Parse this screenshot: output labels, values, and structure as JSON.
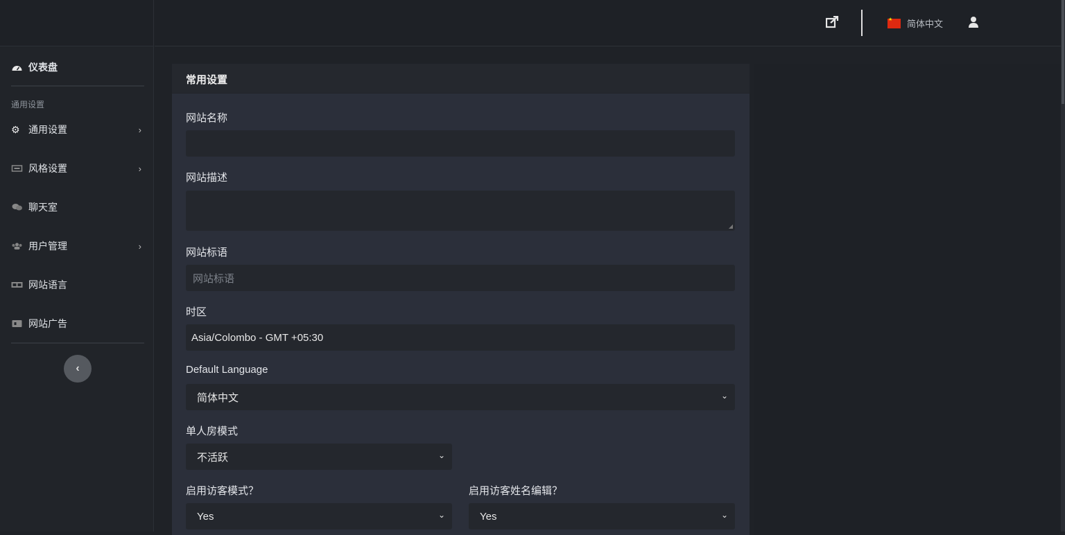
{
  "sidebar": {
    "dashboard": "仪表盘",
    "section_label": "通用设置",
    "items": [
      {
        "label": "通用设置",
        "icon": "gear-icon",
        "has_children": true
      },
      {
        "label": "风格设置",
        "icon": "theme-icon",
        "has_children": true
      },
      {
        "label": "聊天室",
        "icon": "chat-icon",
        "has_children": false
      },
      {
        "label": "用户管理",
        "icon": "users-icon",
        "has_children": true
      },
      {
        "label": "网站语言",
        "icon": "language-icon",
        "has_children": false
      },
      {
        "label": "网站广告",
        "icon": "ad-icon",
        "has_children": false
      }
    ]
  },
  "header": {
    "language": "简体中文"
  },
  "card": {
    "title": "常用设置",
    "site_name_label": "网站名称",
    "site_name_value": "",
    "site_desc_label": "网站描述",
    "site_desc_value": "",
    "slogan_label": "网站标语",
    "slogan_placeholder": "网站标语",
    "timezone_label": "时区",
    "timezone_value": "Asia/Colombo - GMT +05:30",
    "default_language_label": "Default Language",
    "default_language_value": "简体中文",
    "single_room_label": "单人房模式",
    "single_room_value": "不活跃",
    "guest_mode_label": "启用访客模式？",
    "guest_mode_value": "Yes",
    "guest_name_edit_label": "启用访客姓名编辑？",
    "guest_name_edit_value": "Yes"
  }
}
